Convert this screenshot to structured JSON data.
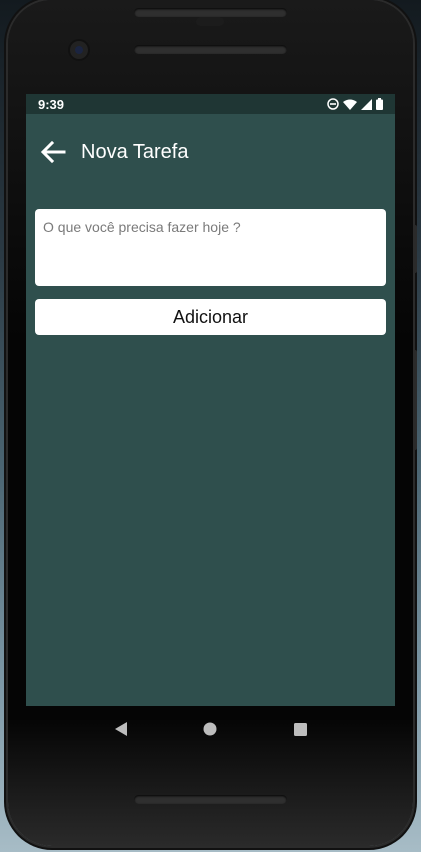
{
  "status_bar": {
    "time": "9:39",
    "icons": [
      "do-not-disturb-icon",
      "wifi-icon",
      "signal-icon",
      "battery-icon"
    ]
  },
  "app_bar": {
    "back_icon": "arrow-left-icon",
    "title": "Nova Tarefa"
  },
  "form": {
    "task_input": {
      "placeholder": "O que você precisa fazer hoje ?",
      "value": ""
    },
    "add_button_label": "Adicionar"
  },
  "nav_bar": {
    "icons": [
      "back-triangle-icon",
      "home-circle-icon",
      "recents-square-icon"
    ]
  },
  "colors": {
    "screen_background": "#2f4f4d",
    "status_bar": "#1f3634",
    "text_on_dark": "#ffffff",
    "button_background": "#ffffff"
  }
}
